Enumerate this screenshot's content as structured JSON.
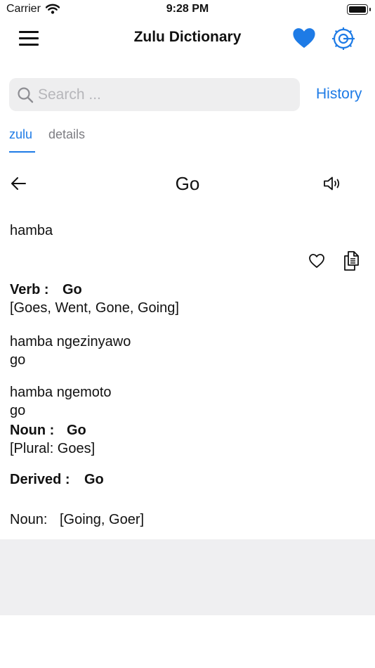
{
  "status_bar": {
    "carrier": "Carrier",
    "time": "9:28 PM"
  },
  "nav": {
    "title": "Zulu Dictionary"
  },
  "search": {
    "placeholder": "Search ...",
    "value": "",
    "history_label": "History"
  },
  "tabs": [
    {
      "label": "zulu",
      "active": true
    },
    {
      "label": "details",
      "active": false
    }
  ],
  "entry": {
    "word": "Go",
    "translation": "hamba",
    "verb": {
      "label": "Verb :",
      "word": "Go",
      "forms": "[Goes, Went, Gone, Going]"
    },
    "examples": [
      {
        "zulu": "hamba ngezinyawo",
        "english": "go"
      },
      {
        "zulu": "hamba ngemoto",
        "english": "go"
      }
    ],
    "noun": {
      "label": "Noun :",
      "word": "Go",
      "plural": "[Plural: Goes]"
    },
    "derived": {
      "label": "Derived :",
      "word": "Go",
      "noun_label": "Noun:",
      "noun_forms": "[Going, Goer]"
    }
  },
  "colors": {
    "accent": "#1e7be6",
    "tab_inactive": "#7d7d82",
    "search_bg": "#eeeeef",
    "band_bg": "#efeff1"
  },
  "icons": [
    "wifi-icon",
    "battery-icon",
    "menu-icon",
    "heart-filled-icon",
    "gear-icon",
    "search-icon",
    "back-arrow-icon",
    "speaker-icon",
    "heart-outline-icon",
    "copy-icon"
  ]
}
